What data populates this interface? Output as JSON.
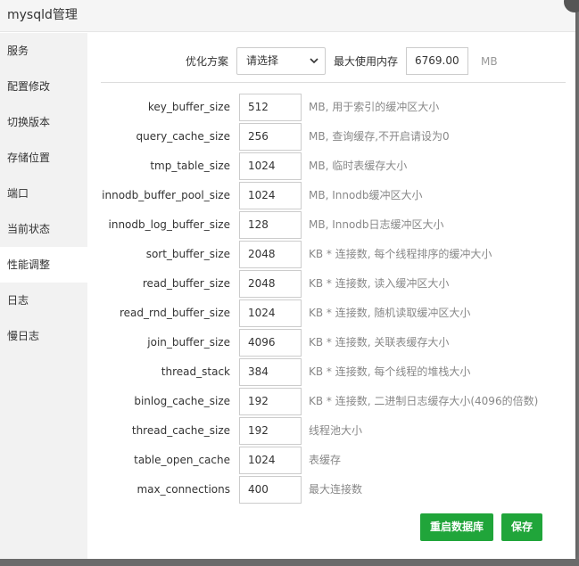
{
  "window": {
    "title": "mysqld管理"
  },
  "sidebar": {
    "items": [
      {
        "label": "服务"
      },
      {
        "label": "配置修改"
      },
      {
        "label": "切换版本"
      },
      {
        "label": "存储位置"
      },
      {
        "label": "端口"
      },
      {
        "label": "当前状态"
      },
      {
        "label": "性能调整",
        "active": true
      },
      {
        "label": "日志"
      },
      {
        "label": "慢日志"
      }
    ]
  },
  "header": {
    "optimize_label": "优化方案",
    "optimize_select": "请选择",
    "max_mem_label": "最大使用内存",
    "max_mem_value": "6769.00",
    "max_mem_unit": "MB"
  },
  "params": [
    {
      "name": "key_buffer_size",
      "value": "512",
      "hint": "MB, 用于索引的缓冲区大小"
    },
    {
      "name": "query_cache_size",
      "value": "256",
      "hint": "MB, 查询缓存,不开启请设为0"
    },
    {
      "name": "tmp_table_size",
      "value": "1024",
      "hint": "MB, 临时表缓存大小"
    },
    {
      "name": "innodb_buffer_pool_size",
      "value": "1024",
      "hint": "MB, Innodb缓冲区大小"
    },
    {
      "name": "innodb_log_buffer_size",
      "value": "128",
      "hint": "MB, Innodb日志缓冲区大小"
    },
    {
      "name": "sort_buffer_size",
      "value": "2048",
      "hint": "KB * 连接数, 每个线程排序的缓冲大小"
    },
    {
      "name": "read_buffer_size",
      "value": "2048",
      "hint": "KB * 连接数, 读入缓冲区大小"
    },
    {
      "name": "read_rnd_buffer_size",
      "value": "1024",
      "hint": "KB * 连接数, 随机读取缓冲区大小"
    },
    {
      "name": "join_buffer_size",
      "value": "4096",
      "hint": "KB * 连接数, 关联表缓存大小"
    },
    {
      "name": "thread_stack",
      "value": "384",
      "hint": "KB * 连接数, 每个线程的堆栈大小"
    },
    {
      "name": "binlog_cache_size",
      "value": "192",
      "hint": "KB * 连接数, 二进制日志缓存大小(4096的倍数)"
    },
    {
      "name": "thread_cache_size",
      "value": "192",
      "hint": "线程池大小"
    },
    {
      "name": "table_open_cache",
      "value": "1024",
      "hint": "表缓存"
    },
    {
      "name": "max_connections",
      "value": "400",
      "hint": "最大连接数"
    }
  ],
  "buttons": {
    "restart": "重启数据库",
    "save": "保存"
  },
  "colors": {
    "accent": "#20a53a",
    "sidebar_bg": "#f2f2f2"
  },
  "icons": {
    "close": "close-icon",
    "select_arrow": "chevron-down-icon"
  }
}
